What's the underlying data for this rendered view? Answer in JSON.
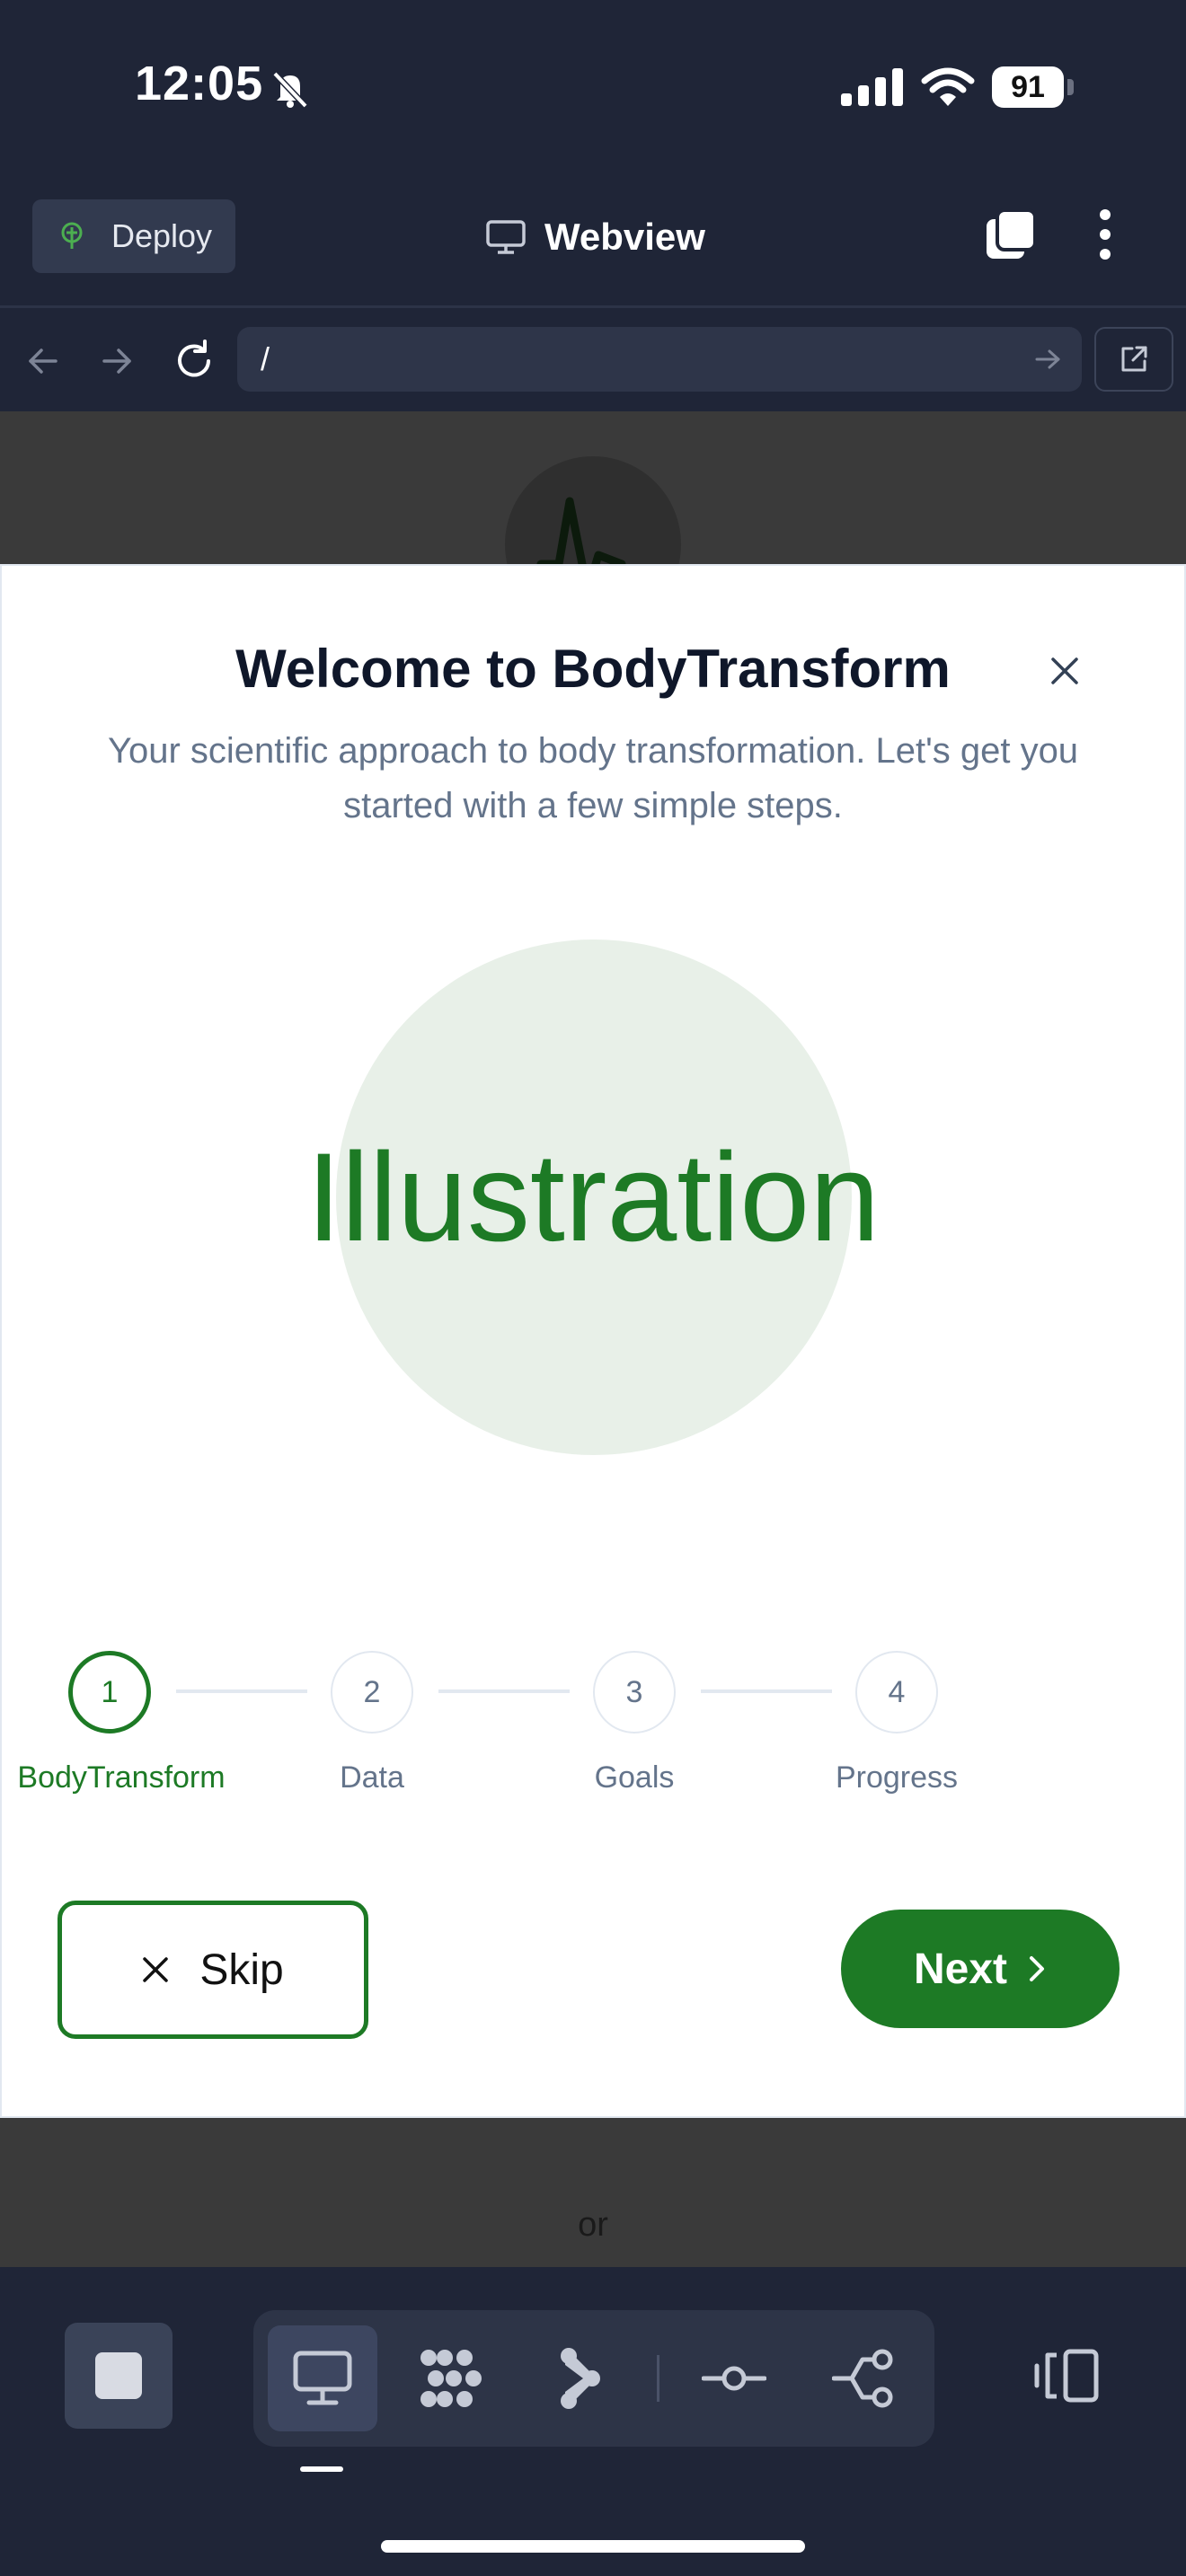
{
  "status_bar": {
    "time": "12:05",
    "battery": "91",
    "icons": [
      "bell-slash-icon",
      "signal-icon",
      "wifi-icon",
      "battery-icon"
    ]
  },
  "app_header": {
    "deploy_label": "Deploy",
    "title": "Webview",
    "icons": [
      "deploy-icon",
      "monitor-icon",
      "copy-icon",
      "more-vertical-icon"
    ]
  },
  "url_bar": {
    "path": "/",
    "icons": [
      "back-arrow-icon",
      "forward-arrow-icon",
      "reload-icon",
      "go-arrow-icon",
      "external-link-icon"
    ]
  },
  "page": {
    "or_text": "or"
  },
  "modal": {
    "title": "Welcome to BodyTransform",
    "subtitle": "Your scientific approach to body transformation. Let's get you started with a few simple steps.",
    "illustration": "Illustration",
    "steps": [
      {
        "number": "1",
        "label": "BodyTransform",
        "active": true
      },
      {
        "number": "2",
        "label": "Data",
        "active": false
      },
      {
        "number": "3",
        "label": "Goals",
        "active": false
      },
      {
        "number": "4",
        "label": "Progress",
        "active": false
      }
    ],
    "skip_label": "Skip",
    "next_label": "Next",
    "accent_color": "#1d7a25"
  },
  "bottom_toolbar": {
    "tools": [
      "stop-icon",
      "desktop-icon",
      "grid-dots-icon",
      "branch-icon",
      "commit-icon",
      "git-branch-icon",
      "panel-toggle-icon"
    ]
  }
}
